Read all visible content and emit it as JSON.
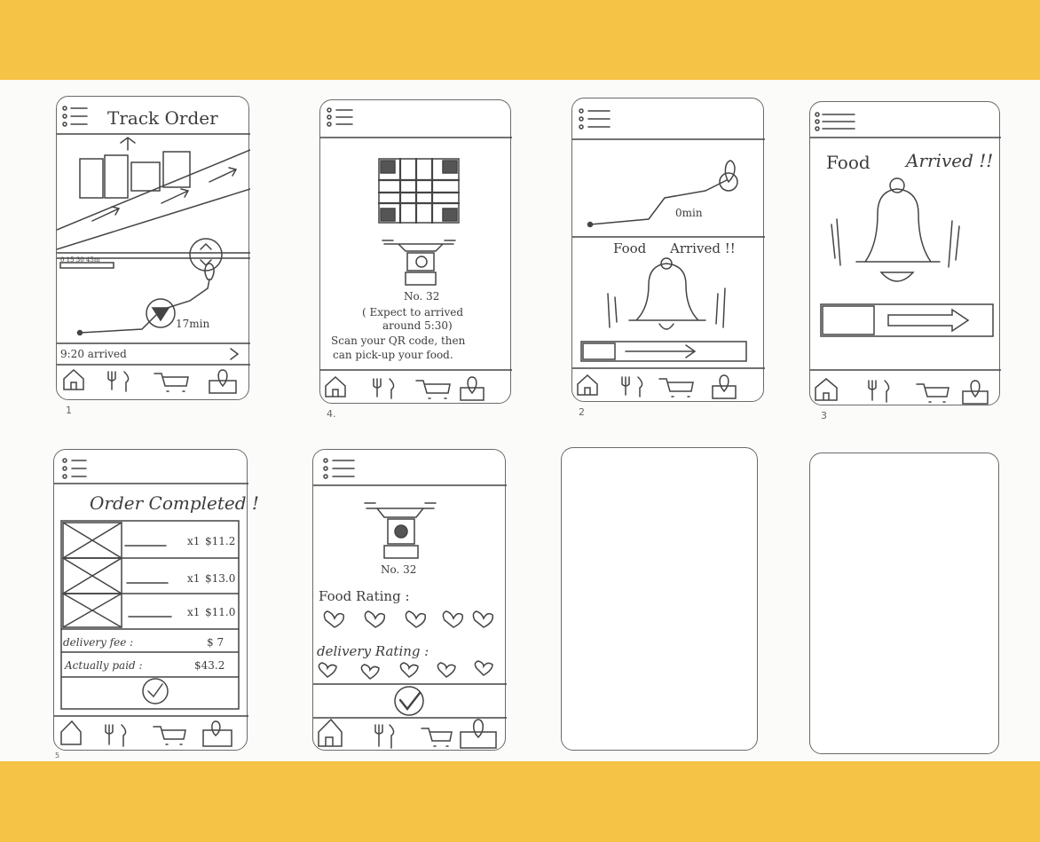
{
  "colors": {
    "band": "#f5c346",
    "pencil": "#3c3c3c",
    "paper": "#fbfbfa"
  },
  "screens": {
    "track": {
      "title": "Track  Order",
      "scale": "0  15  30  45m",
      "eta": "17min",
      "arrived": "9:20 arrived",
      "caption": "1"
    },
    "qr": {
      "drone_no": "No. 32",
      "expect_line1": "( Expect to arrived",
      "expect_line2": "around 5:30)",
      "scan_line1": "Scan your QR code, then",
      "scan_line2": "can pick-up your food.",
      "caption": "4."
    },
    "arrived_map": {
      "eta": "0min",
      "food": "Food",
      "arrived": "Arrived !!",
      "caption": "2"
    },
    "arrived_bell": {
      "food": "Food",
      "arrived": "Arrived !!",
      "caption": "3"
    },
    "completed": {
      "title": "Order Completed !",
      "items": [
        {
          "qty": "x1",
          "price": "$11.2"
        },
        {
          "qty": "x1",
          "price": "$13.0"
        },
        {
          "qty": "x1",
          "price": "$11.0"
        }
      ],
      "delivery_label": "delivery fee :",
      "delivery_value": "$ 7",
      "paid_label": "Actually paid :",
      "paid_value": "$43.2",
      "caption": "5"
    },
    "rating": {
      "drone_no": "No. 32",
      "food_rating": "Food Rating :",
      "delivery_rating": "delivery  Rating :"
    }
  },
  "icons": [
    "menu-icon",
    "home-icon",
    "fork-knife-icon",
    "cart-icon",
    "location-icon",
    "bell-icon",
    "check-icon",
    "heart-icon",
    "drone-icon",
    "qr-code-icon"
  ]
}
